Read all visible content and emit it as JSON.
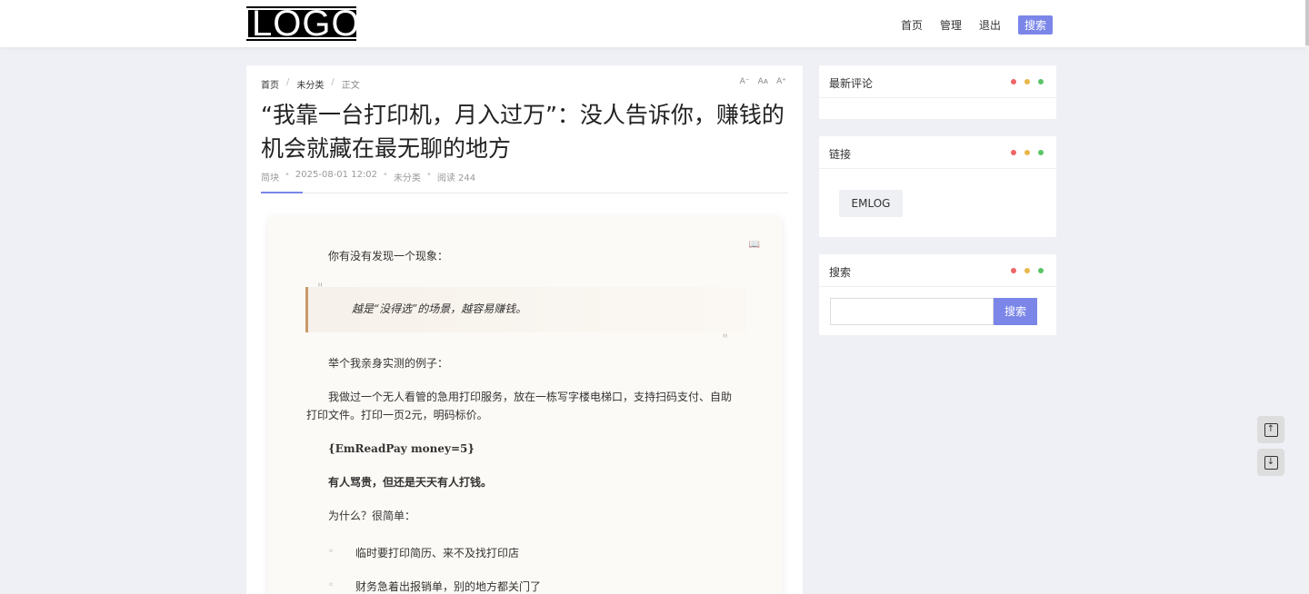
{
  "header": {
    "logo_text": "LOGO",
    "nav": [
      "首页",
      "管理",
      "退出"
    ],
    "search_label": "搜索"
  },
  "article": {
    "breadcrumb": [
      "首页",
      "未分类",
      "正文"
    ],
    "font_tools": [
      "A⁻",
      "Aᴀ",
      "A⁺"
    ],
    "title": "“我靠一台打印机，月入过万”：没人告诉你，赚钱的机会就藏在最无聊的地方",
    "meta": {
      "author": "简块",
      "date": "2025-08-01 12:02",
      "category": "未分类",
      "reads": "阅读 244"
    },
    "book_icon": "book-icon",
    "paragraphs": {
      "p1": "你有没有发现一个现象：",
      "quote": "越是“没得选”的场景，越容易赚钱。",
      "p2": "举个我亲身实测的例子：",
      "p3a": "我做过一个无人看管的急用打印服务，放在一栋写字楼电梯口，支持扫码支付、自助",
      "p3b": "打印文件。打印一页2元，明码标价。",
      "p4": "{EmReadPay money=5}",
      "p5": "有人骂贵，但还是天天有人打钱。",
      "p6": "为什么？很简单：",
      "li1": "临时要打印简历、来不及找打印店",
      "li2": "财务急着出报销单，别的地方都关门了"
    }
  },
  "sidebar": {
    "recent_comments_title": "最新评论",
    "links_title": "链接",
    "link_item": "EMLOG",
    "search_title": "搜索",
    "search_button": "搜索",
    "search_placeholder": "",
    "dot_colors": [
      "#e66",
      "#e8b84a",
      "#5cc466"
    ]
  },
  "float": {
    "top_icon": "arrow-up-icon",
    "bottom_icon": "arrow-down-icon"
  }
}
